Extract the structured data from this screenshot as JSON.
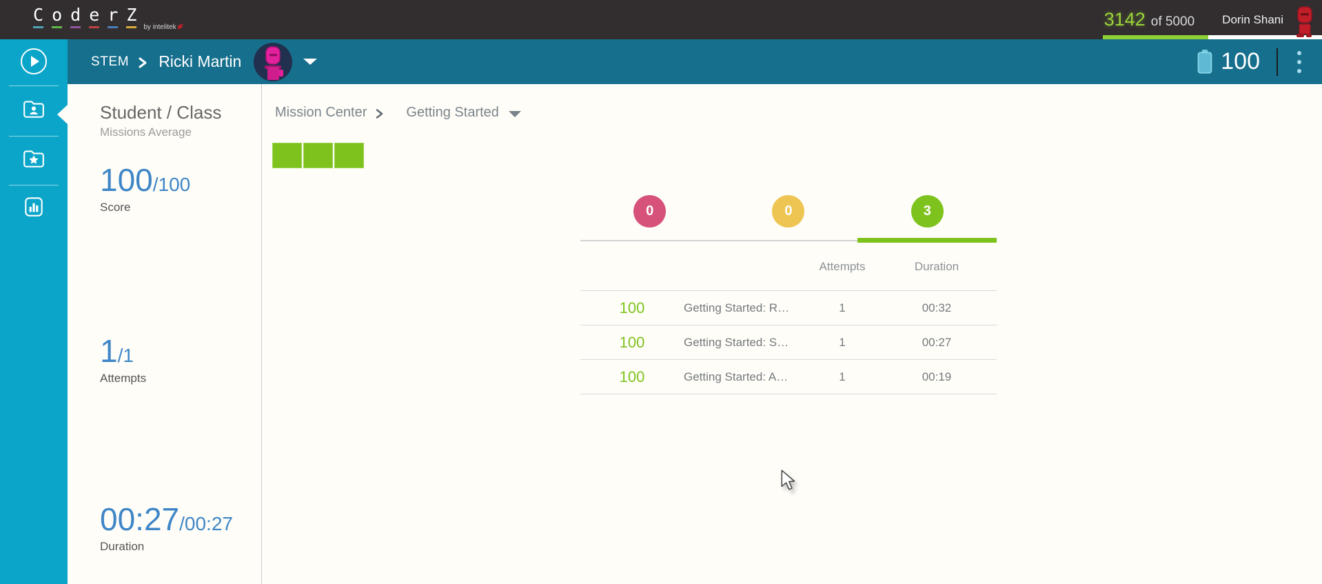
{
  "colors": {
    "topbar_bg": "#322e2f",
    "header_teal": "#166f8d",
    "sidebar_cyan": "#0ba5c9",
    "accent_green": "#7ec31d",
    "accent_pink": "#d6527a",
    "accent_yellow": "#eec552",
    "metric_blue": "#3e86c7",
    "page_bg": "#fffdf8"
  },
  "topbar": {
    "logo": {
      "letters": [
        {
          "ch": "C",
          "underline": "#4fa3b5"
        },
        {
          "ch": "o",
          "underline": "#62b548"
        },
        {
          "ch": "d",
          "underline": "#9056a0"
        },
        {
          "ch": "e",
          "underline": "#c04343"
        },
        {
          "ch": "r",
          "underline": "#4a7fb5"
        },
        {
          "ch": "Z",
          "underline": "#d8a839"
        }
      ],
      "byline": "by intelitek"
    },
    "quota_value": "3142",
    "quota_of": "of 5000",
    "quota_progress_percent": 48,
    "user_name": "Dorin Shani"
  },
  "header": {
    "class_name": "STEM",
    "student_name": "Ricki Martin",
    "battery_value": "100"
  },
  "sidebar": {
    "items": [
      {
        "icon": "play-icon",
        "selected": false
      },
      {
        "icon": "folder-user-icon",
        "selected": true
      },
      {
        "icon": "folder-star-icon",
        "selected": false
      },
      {
        "icon": "bar-chart-icon",
        "selected": false
      }
    ]
  },
  "stats_panel": {
    "title": "Student / Class",
    "subtitle": "Missions Average",
    "metrics": [
      {
        "value": "100",
        "total": "/100",
        "label": "Score"
      },
      {
        "value": "1",
        "total": "/1",
        "label": "Attempts"
      },
      {
        "value": "00:27",
        "total": "/00:27",
        "label": "Duration"
      }
    ]
  },
  "main": {
    "breadcrumb_parent": "Mission Center",
    "breadcrumb_current": "Getting Started",
    "progress_blocks_count": 3,
    "tabs": [
      {
        "count": "0",
        "color": "#d6527a",
        "active": false
      },
      {
        "count": "0",
        "color": "#eec552",
        "active": false
      },
      {
        "count": "3",
        "color": "#7ec31d",
        "active": true
      }
    ],
    "table": {
      "headers": {
        "attempts": "Attempts",
        "duration": "Duration"
      },
      "rows": [
        {
          "score": "100",
          "mission": "Getting Started: R…",
          "attempts": "1",
          "duration": "00:32"
        },
        {
          "score": "100",
          "mission": "Getting Started: S…",
          "attempts": "1",
          "duration": "00:27"
        },
        {
          "score": "100",
          "mission": "Getting Started: A…",
          "attempts": "1",
          "duration": "00:19"
        }
      ]
    }
  }
}
